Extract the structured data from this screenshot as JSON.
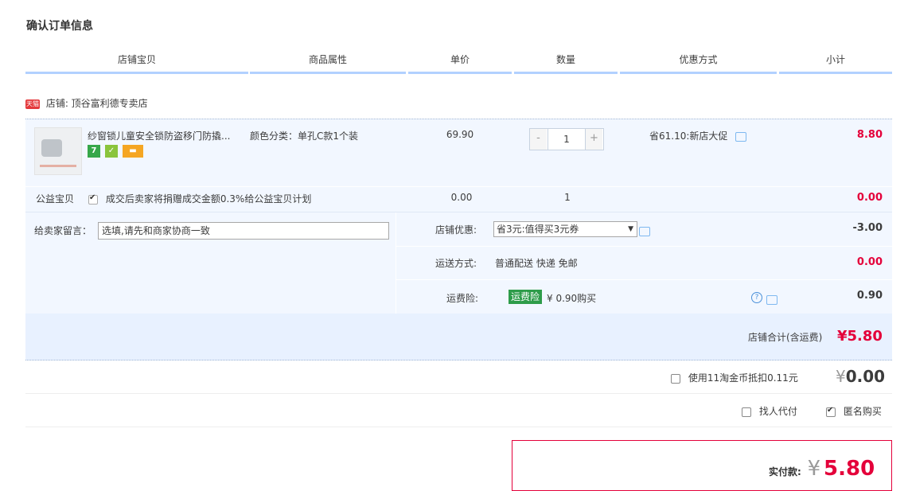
{
  "page_title": "确认订单信息",
  "columns": [
    "店铺宝贝",
    "商品属性",
    "单价",
    "数量",
    "优惠方式",
    "小计"
  ],
  "shop": {
    "badge": "天猫",
    "label": "店铺: 顶谷富利德专卖店"
  },
  "item": {
    "name": "纱窗锁儿童安全锁防盗移门防撬...",
    "attr": "颜色分类：单孔C款1个装",
    "price": "69.90",
    "quantity": "1",
    "minus": "-",
    "plus": "+",
    "discount": "省61.10:新店大促",
    "subtotal": "8.80",
    "badges": [
      "7"
    ]
  },
  "charity": {
    "label": "公益宝贝",
    "text": "成交后卖家将捐赠成交金额0.3%给公益宝贝计划",
    "price": "0.00",
    "quantity": "1",
    "subtotal": "0.00",
    "checked": true
  },
  "message": {
    "label": "给卖家留言：",
    "placeholder": "选填,请先和商家协商一致"
  },
  "shop_coupon": {
    "label": "店铺优惠:",
    "selected": "省3元:值得买3元券",
    "amount": "-3.00"
  },
  "shipping": {
    "label": "运送方式:",
    "value": "普通配送 快递 免邮",
    "amount": "0.00"
  },
  "insurance": {
    "label": "运费险:",
    "badge": "运费险",
    "text": "¥ 0.90购买",
    "amount": "0.90"
  },
  "shop_total": {
    "label": "店铺合计(含运费)",
    "amount": "¥5.80"
  },
  "coins": {
    "text": "使用11淘金币抵扣0.11元",
    "currency": "¥",
    "amount": "0.00"
  },
  "options": {
    "proxy": "找人代付",
    "anonymous": "匿名购买",
    "anonymous_checked": true
  },
  "pay": {
    "label": "实付款:",
    "currency": "¥",
    "amount": "5.80"
  },
  "colors": {
    "accent_red": "#e4003a",
    "header_line": "#b2d1ff",
    "item_bg": "#f2f7ff"
  }
}
